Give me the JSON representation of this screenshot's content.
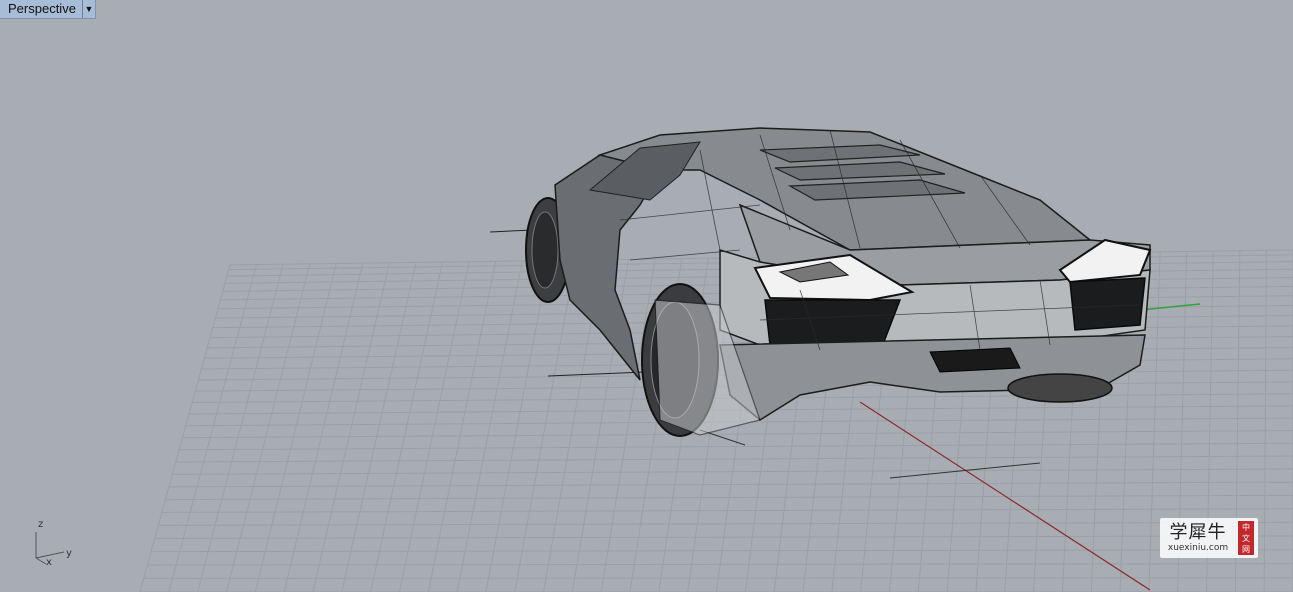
{
  "viewport": {
    "name": "Perspective",
    "menu_icon": "triangle-down-icon"
  },
  "axes_widget": {
    "z": "z",
    "y": "y",
    "x": "x"
  },
  "colors": {
    "background": "#a8adb3",
    "grid": "#9a9fa5",
    "x_axis": "#8b2a2a",
    "y_axis": "#2fa33a"
  },
  "watermark": {
    "chinese": "学犀牛",
    "url": "xuexiniu.com",
    "badge": [
      "中",
      "文",
      "网"
    ]
  }
}
